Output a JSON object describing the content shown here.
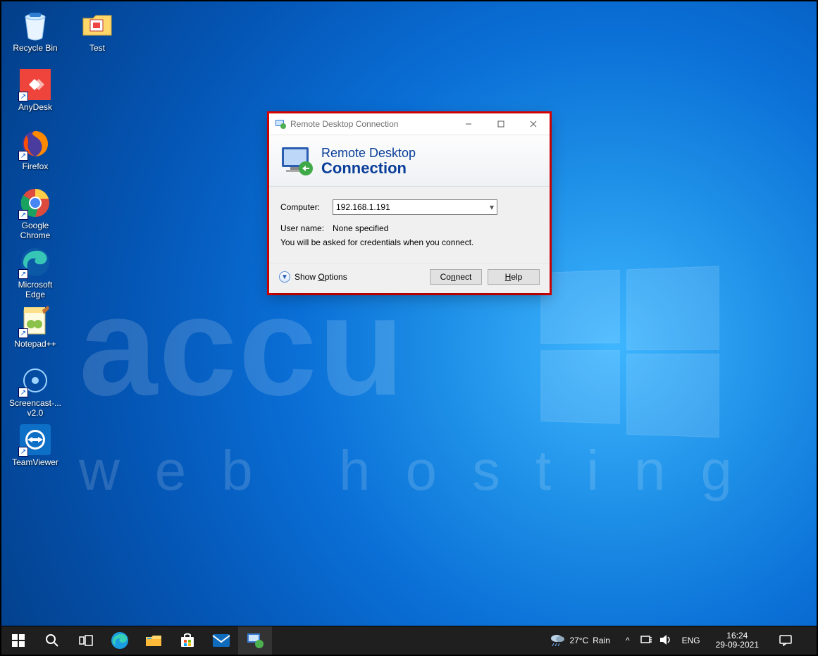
{
  "desktop_icons": [
    {
      "label": "Recycle Bin"
    },
    {
      "label": "Test"
    },
    {
      "label": "AnyDesk"
    },
    {
      "label": "Firefox"
    },
    {
      "label": "Google\nChrome"
    },
    {
      "label": "Microsoft\nEdge"
    },
    {
      "label": "Notepad++"
    },
    {
      "label": "Screencast-...\nv2.0"
    },
    {
      "label": "TeamViewer"
    }
  ],
  "watermark": {
    "top": "accu",
    "bottom": "web hosting"
  },
  "rdc": {
    "title": "Remote Desktop Connection",
    "banner_line1": "Remote Desktop",
    "banner_line2": "Connection",
    "computer_label": "Computer:",
    "computer_value": "192.168.1.191",
    "username_label": "User name:",
    "username_value": "None specified",
    "hint": "You will be asked for credentials when you connect.",
    "showoptions_pre": "Show ",
    "showoptions_u": "O",
    "showoptions_post": "ptions",
    "connect_pre": "Co",
    "connect_u": "n",
    "connect_post": "nect",
    "help_pre": "",
    "help_u": "H",
    "help_post": "elp"
  },
  "taskbar": {
    "weather_temp": "27°C",
    "weather_cond": "Rain",
    "lang": "ENG",
    "time": "16:24",
    "date": "29-09-2021"
  }
}
